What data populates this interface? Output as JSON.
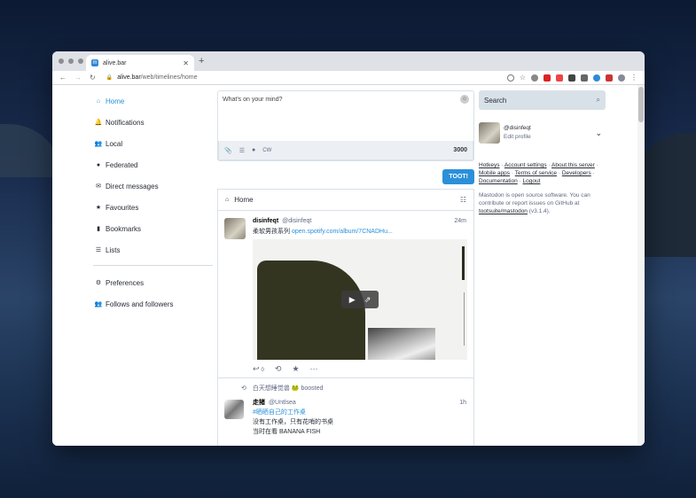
{
  "browser": {
    "tab_title": "alive.bar",
    "tab_favicon": "mastodon-icon",
    "url_domain": "alive.bar",
    "url_path": "/web/timelines/home"
  },
  "nav": {
    "items": [
      {
        "label": "Home",
        "icon": "home-icon",
        "active": true
      },
      {
        "label": "Notifications",
        "icon": "bell-icon"
      },
      {
        "label": "Local",
        "icon": "users-icon"
      },
      {
        "label": "Federated",
        "icon": "globe-icon"
      },
      {
        "label": "Direct messages",
        "icon": "envelope-icon"
      },
      {
        "label": "Favourites",
        "icon": "star-icon"
      },
      {
        "label": "Bookmarks",
        "icon": "bookmark-icon"
      },
      {
        "label": "Lists",
        "icon": "list-icon"
      }
    ],
    "secondary": [
      {
        "label": "Preferences",
        "icon": "gear-icon"
      },
      {
        "label": "Follows and followers",
        "icon": "users-icon"
      }
    ]
  },
  "compose": {
    "placeholder": "What's on your mind?",
    "cw_label": "CW",
    "counter": "3000",
    "submit_label": "TOOT!"
  },
  "column": {
    "title": "Home"
  },
  "statuses": [
    {
      "name": "disinfeqt",
      "acct": "@disinfeqt",
      "time": "24m",
      "text": "柔软男孩系列 ",
      "link": "open.spotify.com/album/7CNADHu...",
      "reply_count": "0"
    },
    {
      "boosted_by": "白天想睡觉兽 🐸 boosted",
      "name": "走猪",
      "acct": "@Untlsea",
      "time": "1h",
      "hashtag": "#晒晒自己的工作桌",
      "line1": "没有工作桌，只有花哨的书桌",
      "line2": "当时在看 BANANA FISH"
    }
  ],
  "sidebar": {
    "search_placeholder": "Search",
    "profile_acct": "@disinfeqt",
    "profile_edit": "Edit profile",
    "links_text_1": "Hotkeys",
    "links_text_2": "Account settings",
    "links_text_3": "About this server",
    "links_text_4": "Mobile apps",
    "links_text_5": "Terms of service",
    "links_text_6": "Developers",
    "links_text_7": "Documentation",
    "links_text_8": "Logout",
    "about_text": "Mastodon is open source software. You can contribute or report issues on GitHub at",
    "about_link": "tootsuite/mastodon",
    "about_version": "(v3.1.4)."
  }
}
